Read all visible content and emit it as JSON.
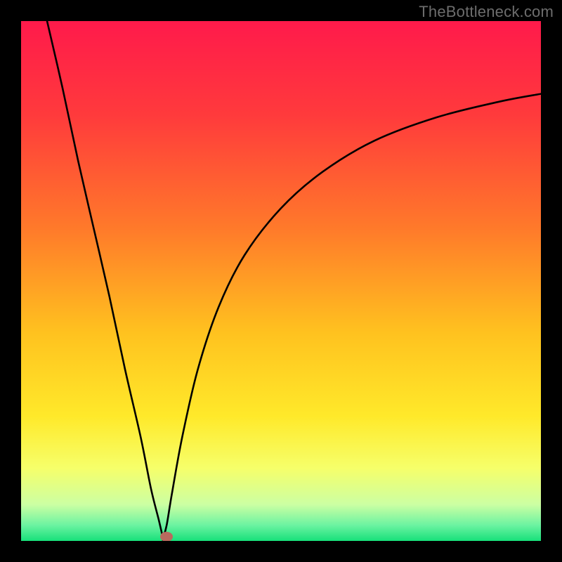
{
  "attribution": "TheBottleneck.com",
  "colors": {
    "frame_bg": "#000000",
    "gradient_stops": [
      {
        "pct": 0,
        "color": "#ff1a4b"
      },
      {
        "pct": 18,
        "color": "#ff3a3c"
      },
      {
        "pct": 40,
        "color": "#ff7a2a"
      },
      {
        "pct": 60,
        "color": "#ffc21f"
      },
      {
        "pct": 76,
        "color": "#ffe92a"
      },
      {
        "pct": 86,
        "color": "#f6ff6a"
      },
      {
        "pct": 93,
        "color": "#ccffa3"
      },
      {
        "pct": 97,
        "color": "#6bf3a1"
      },
      {
        "pct": 100,
        "color": "#17e07a"
      }
    ],
    "curve": "#000000",
    "marker": "#b96a5e"
  },
  "chart_data": {
    "type": "line",
    "title": "",
    "xlabel": "",
    "ylabel": "",
    "xlim": [
      0,
      100
    ],
    "ylim": [
      0,
      100
    ],
    "legend": false,
    "grid": false,
    "curve_note": "V-shaped curve with minimum near x≈27; y rises steeply on both sides (bottleneck-style chart).",
    "series": [
      {
        "name": "left-branch",
        "x": [
          5,
          8,
          11,
          14,
          17,
          20,
          23,
          25,
          26.5,
          27.3
        ],
        "y": [
          100,
          87,
          73,
          60,
          47,
          33,
          20,
          10,
          4,
          0.5
        ]
      },
      {
        "name": "right-branch",
        "x": [
          27.3,
          28,
          29,
          31,
          34,
          38,
          43,
          50,
          58,
          68,
          80,
          92,
          100
        ],
        "y": [
          0.5,
          3,
          9,
          20,
          33,
          45,
          55,
          64,
          71,
          77,
          81.5,
          84.5,
          86
        ]
      }
    ],
    "marker": {
      "x": 28.0,
      "y": 0.8
    }
  }
}
